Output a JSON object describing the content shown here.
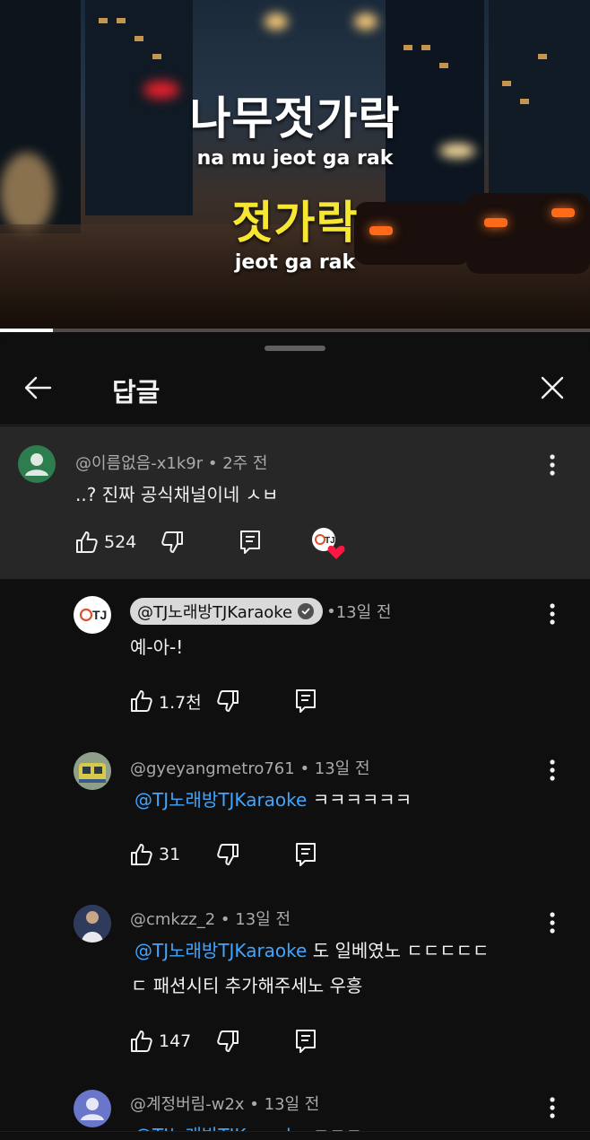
{
  "video": {
    "line1": "나무젓가락",
    "line2": "na mu jeot ga rak",
    "line3": "젓가락",
    "line4": "jeot ga rak",
    "progress_fraction": 0.09
  },
  "sheet": {
    "title": "답글"
  },
  "parent_comment": {
    "author": "@이름없음-x1k9r",
    "time": "2주 전",
    "text": "..? 진짜 공식채널이네 ㅅㅂ",
    "likes": "524"
  },
  "replies": [
    {
      "author": "@TJ노래방TJKaraoke",
      "time": "13일 전",
      "text": "예-아-!",
      "likes": "1.7천",
      "avatar_text": "TJ"
    },
    {
      "author": "@gyeyangmetro761",
      "time": "13일 전",
      "mention": "@TJ노래방TJKaraoke",
      "text": "ㅋㅋㅋㅋㅋㅋ",
      "likes": "31"
    },
    {
      "author": "@cmkzz_2",
      "time": "13일 전",
      "mention": "@TJ노래방TJKaraoke",
      "text": "도 일베였노 ㄷㄷㄷㄷㄷ",
      "text2": "ㄷ 패션시티 추가해주세노 우흥",
      "likes": "147"
    },
    {
      "author": "@계정버림-w2x",
      "time": "13일 전",
      "mention": "@TJ노래방TJKaraoke",
      "text": "ㅋㅋㅋ"
    }
  ],
  "separator": " • ",
  "colors": {
    "background": "#0f0f0f",
    "highlight": "#272727",
    "mention": "#3ea6ff",
    "subtitle_yellow": "#f7e733"
  },
  "icons": [
    "back-arrow-icon",
    "close-icon",
    "like-icon",
    "dislike-icon",
    "reply-icon",
    "more-vert-icon",
    "verified-check-icon",
    "creator-heart-icon"
  ]
}
